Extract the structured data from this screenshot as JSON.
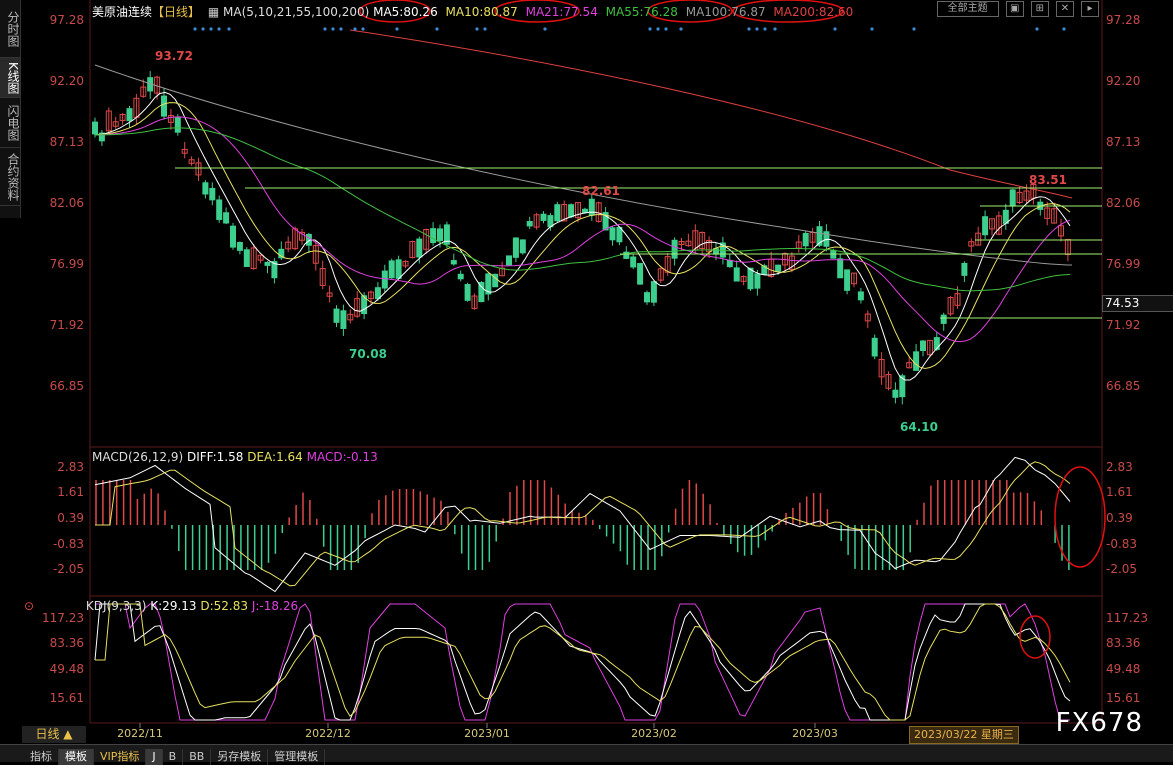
{
  "left_tabs": [
    "分时图",
    "K线图",
    "闪电图",
    "合约资料"
  ],
  "header": {
    "title": "美原油连续",
    "period": "【日线】",
    "ma_label": "MA(5,10,21,55,100,200)",
    "ma5": "MA5:80.26",
    "ma10": "MA10:80.87",
    "ma21": "MA21:77.54",
    "ma55": "MA55:76.28",
    "ma100": "MA100:76.87",
    "ma200": "MA200:82.60"
  },
  "top_right": {
    "theme": "全部主题",
    "btn_min": "▣",
    "btn_float": "⊞",
    "btn_close": "✕",
    "btn_more": "▸"
  },
  "price_axis": {
    "ticks": [
      "97.28",
      "92.20",
      "87.13",
      "82.06",
      "76.99",
      "71.92",
      "66.85"
    ],
    "current": "74.53"
  },
  "price_annotations": {
    "high1": "93.72",
    "low1": "70.08",
    "high2": "82.61",
    "high3": "83.51",
    "low2": "64.10"
  },
  "macd": {
    "label": "MACD(26,12,9)",
    "diff": "DIFF:1.58",
    "dea": "DEA:1.64",
    "macd": "MACD:-0.13",
    "ticks": [
      "2.83",
      "1.61",
      "0.39",
      "-0.83",
      "-2.05"
    ]
  },
  "kdj": {
    "label": "KDJ(9,3,3)",
    "k": "K:29.13",
    "d": "D:52.83",
    "j": "J:-18.26",
    "ticks": [
      "117.23",
      "83.36",
      "49.48",
      "15.61"
    ]
  },
  "time_axis": [
    "2022/11",
    "2022/12",
    "2023/01",
    "2023/02",
    "2023/03"
  ],
  "date_readout": "2023/03/22 星期三",
  "day_button": "日线 ▲",
  "bottom_tabs": [
    "指标",
    "模板",
    "VIP指标",
    "J",
    "B",
    "BB",
    "另存模板",
    "管理模板"
  ],
  "watermark": "FX678",
  "colors": {
    "up": "#e04848",
    "down": "#3ccf8e",
    "ma5": "#ffffff",
    "ma10": "#e8e060",
    "ma21": "#e040e0",
    "ma55": "#40c040",
    "ma100": "#999999",
    "ma200": "#e04040",
    "axis": "#c84a4a"
  }
}
